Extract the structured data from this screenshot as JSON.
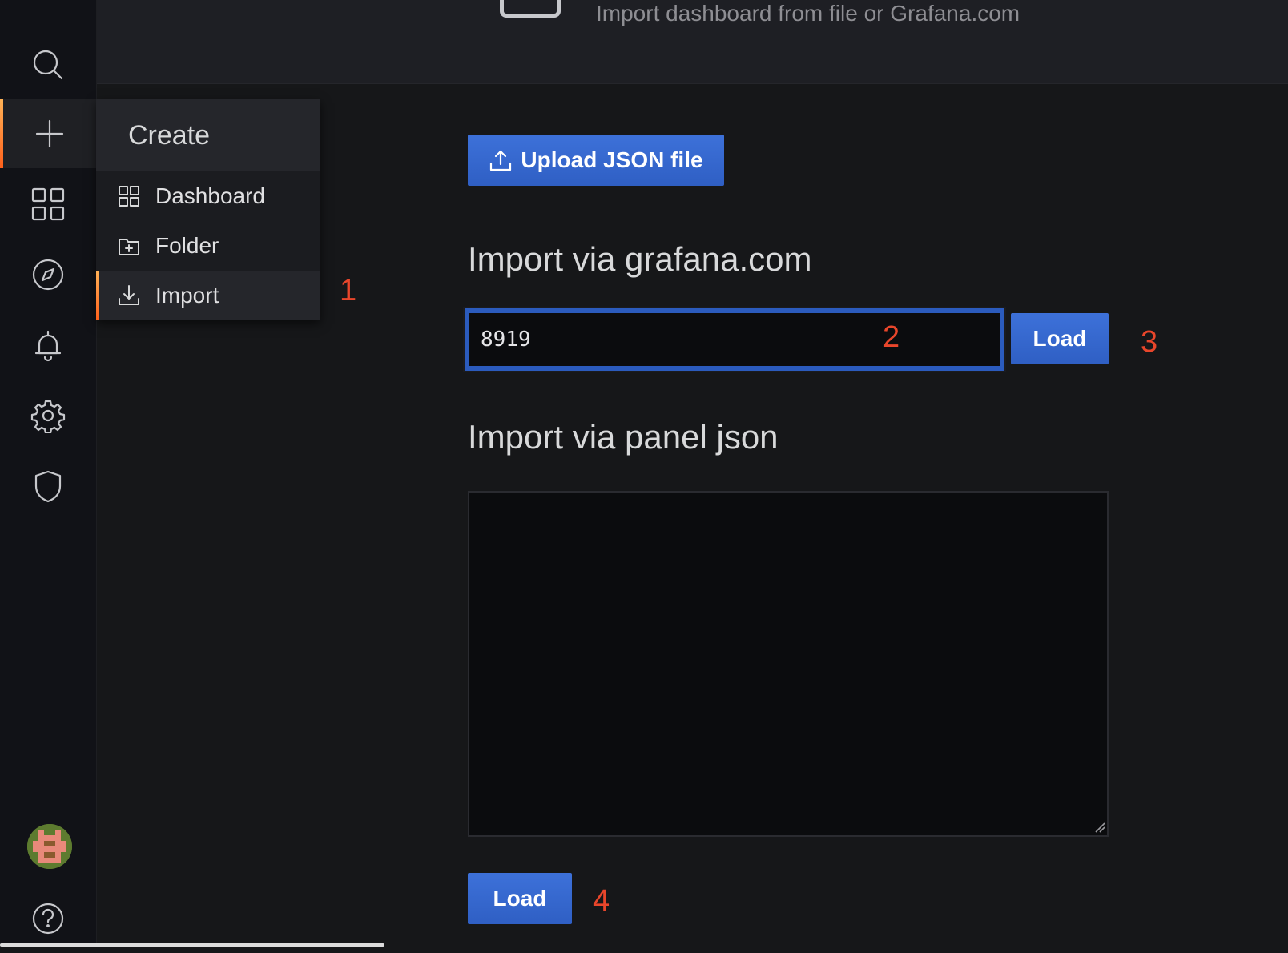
{
  "page": {
    "subtitle": "Import dashboard from file or Grafana.com"
  },
  "sidebar": {
    "items": [
      {
        "name": "search-icon"
      },
      {
        "name": "plus-icon"
      },
      {
        "name": "dashboards-icon"
      },
      {
        "name": "compass-icon"
      },
      {
        "name": "bell-icon"
      },
      {
        "name": "gear-icon"
      },
      {
        "name": "shield-icon"
      }
    ],
    "active": "plus-icon"
  },
  "create_menu": {
    "header": "Create",
    "items": [
      {
        "label": "Dashboard",
        "icon": "dashboard-grid-icon"
      },
      {
        "label": "Folder",
        "icon": "folder-plus-icon"
      },
      {
        "label": "Import",
        "icon": "download-icon"
      }
    ],
    "active_index": 2
  },
  "upload": {
    "label": "Upload JSON file",
    "icon": "upload-icon"
  },
  "grafana_com": {
    "heading": "Import via grafana.com",
    "input_value": "8919",
    "load_label": "Load"
  },
  "panel_json": {
    "heading": "Import via panel json",
    "textarea_value": "",
    "load_label": "Load"
  },
  "annotations": [
    "1",
    "2",
    "3",
    "4"
  ],
  "colors": {
    "accent_blue": "#3d71d9",
    "annotation_red": "#e8462b",
    "active_gradient_top": "#ffb357",
    "active_gradient_bottom": "#ff5f1a",
    "background": "#161719"
  }
}
